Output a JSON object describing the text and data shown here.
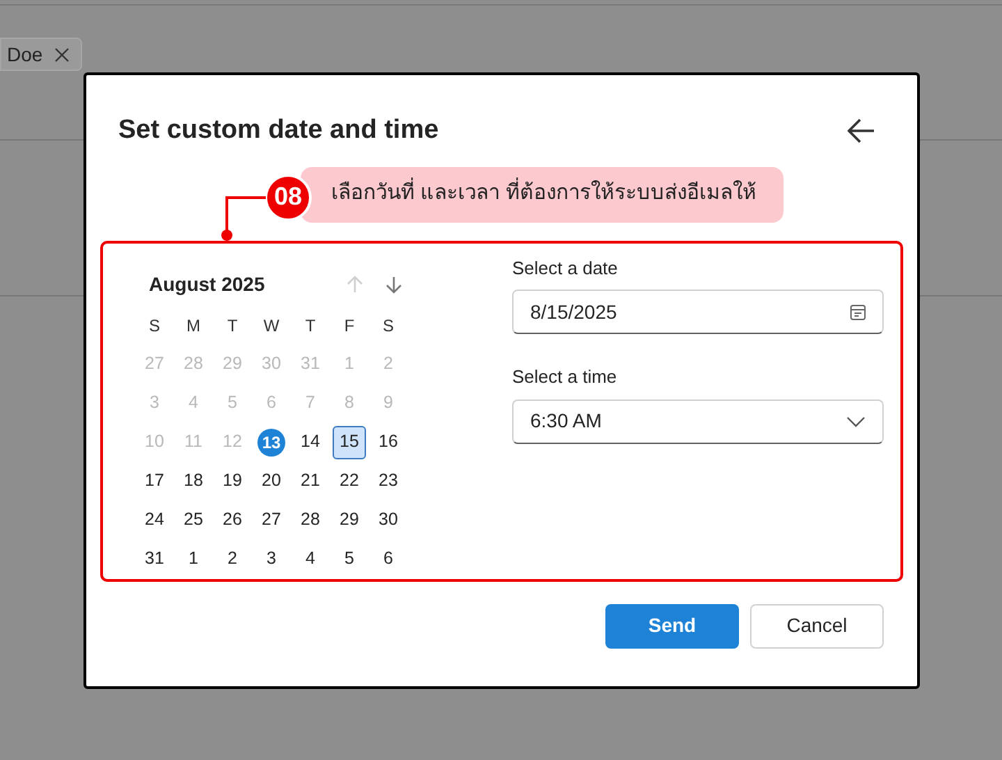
{
  "background_tab": {
    "label": "Doe"
  },
  "dialog": {
    "title": "Set custom date and time",
    "annotation": {
      "number": "08",
      "text": "เลือกวันที่ และเวลา ที่ต้องการให้ระบบส่งอีเมลให้"
    },
    "calendar": {
      "month": "August 2025",
      "prev_disabled": true,
      "weekdays": [
        "S",
        "M",
        "T",
        "W",
        "T",
        "F",
        "S"
      ],
      "weeks": [
        [
          {
            "label": "27",
            "kind": "outside",
            "selected": false
          },
          {
            "label": "28",
            "kind": "outside",
            "selected": false
          },
          {
            "label": "29",
            "kind": "outside",
            "selected": false
          },
          {
            "label": "30",
            "kind": "outside",
            "selected": false
          },
          {
            "label": "31",
            "kind": "outside",
            "selected": false
          },
          {
            "label": "1",
            "kind": "outside",
            "selected": false
          },
          {
            "label": "2",
            "kind": "outside",
            "selected": false
          }
        ],
        [
          {
            "label": "3",
            "kind": "outside",
            "selected": false
          },
          {
            "label": "4",
            "kind": "outside",
            "selected": false
          },
          {
            "label": "5",
            "kind": "outside",
            "selected": false
          },
          {
            "label": "6",
            "kind": "outside",
            "selected": false
          },
          {
            "label": "7",
            "kind": "outside",
            "selected": false
          },
          {
            "label": "8",
            "kind": "outside",
            "selected": false
          },
          {
            "label": "9",
            "kind": "outside",
            "selected": false
          }
        ],
        [
          {
            "label": "10",
            "kind": "outside",
            "selected": false
          },
          {
            "label": "11",
            "kind": "outside",
            "selected": false
          },
          {
            "label": "12",
            "kind": "outside",
            "selected": false
          },
          {
            "label": "13",
            "kind": "today",
            "selected": false
          },
          {
            "label": "14",
            "kind": "normal",
            "selected": false
          },
          {
            "label": "15",
            "kind": "normal",
            "selected": true
          },
          {
            "label": "16",
            "kind": "normal",
            "selected": false
          }
        ],
        [
          {
            "label": "17",
            "kind": "normal",
            "selected": false
          },
          {
            "label": "18",
            "kind": "normal",
            "selected": false
          },
          {
            "label": "19",
            "kind": "normal",
            "selected": false
          },
          {
            "label": "20",
            "kind": "normal",
            "selected": false
          },
          {
            "label": "21",
            "kind": "normal",
            "selected": false
          },
          {
            "label": "22",
            "kind": "normal",
            "selected": false
          },
          {
            "label": "23",
            "kind": "normal",
            "selected": false
          }
        ],
        [
          {
            "label": "24",
            "kind": "normal",
            "selected": false
          },
          {
            "label": "25",
            "kind": "normal",
            "selected": false
          },
          {
            "label": "26",
            "kind": "normal",
            "selected": false
          },
          {
            "label": "27",
            "kind": "normal",
            "selected": false
          },
          {
            "label": "28",
            "kind": "normal",
            "selected": false
          },
          {
            "label": "29",
            "kind": "normal",
            "selected": false
          },
          {
            "label": "30",
            "kind": "normal",
            "selected": false
          }
        ],
        [
          {
            "label": "31",
            "kind": "normal",
            "selected": false
          },
          {
            "label": "1",
            "kind": "normal",
            "selected": false
          },
          {
            "label": "2",
            "kind": "normal",
            "selected": false
          },
          {
            "label": "3",
            "kind": "normal",
            "selected": false
          },
          {
            "label": "4",
            "kind": "normal",
            "selected": false
          },
          {
            "label": "5",
            "kind": "normal",
            "selected": false
          },
          {
            "label": "6",
            "kind": "normal",
            "selected": false
          }
        ]
      ]
    },
    "date_field": {
      "label": "Select a date",
      "value": "8/15/2025"
    },
    "time_field": {
      "label": "Select a time",
      "value": "6:30 AM"
    },
    "buttons": [
      {
        "label": "Send",
        "kind": "primary"
      },
      {
        "label": "Cancel",
        "kind": "secondary"
      }
    ]
  }
}
